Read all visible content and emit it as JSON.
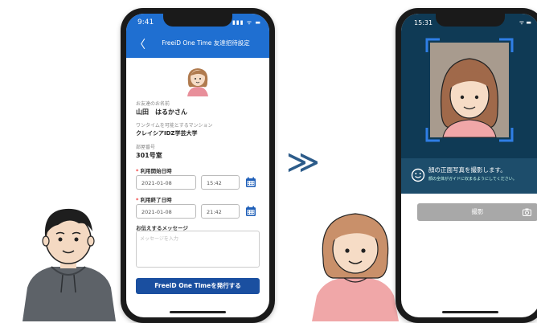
{
  "phone1": {
    "status_time": "9:41",
    "status_icons": "▮▮▮ ᯤ ▬",
    "header_title": "FreeiD One Time 友達招待設定",
    "back_glyph": "〈",
    "friend_name_label": "お友達のお名前",
    "friend_name": "山田　はるかさん",
    "mansion_label": "ワンタイムを可能とするマンション",
    "mansion_name": "クレイシアIDZ学芸大学",
    "room_label": "部屋番号",
    "room_value": "301号室",
    "start_label": "利用開始日時",
    "start_date": "2021-01-08",
    "start_time": "15:42",
    "end_label": "利用終了日時",
    "end_date": "2021-01-08",
    "end_time": "21:42",
    "message_label": "お伝えするメッセージ",
    "message_placeholder": "メッセージを入力",
    "issue_button": "FreeiD One Timeを発行する",
    "required_mark": "*"
  },
  "arrow_glyph": "≫",
  "phone2": {
    "status_time": "15:31",
    "status_icons": "ᯤ ▬",
    "guide_main": "顔の正面写真を撮影します。",
    "guide_sub": "顔の全体がガイドに収まるようにしてください。",
    "shoot_button": "撮影"
  },
  "icons": {
    "calendar": "calendar-icon",
    "smile": "smile-icon",
    "camera": "camera-icon",
    "back": "back-chevron-icon"
  },
  "colors": {
    "header_blue": "#1f6fd1",
    "button_navy": "#1a4fa0",
    "calendar_blue": "#1f5fb8",
    "camera_bg": "#0f3a55",
    "guide_bg": "#1d4d6b",
    "shoot_gray": "#a8a8a8"
  }
}
